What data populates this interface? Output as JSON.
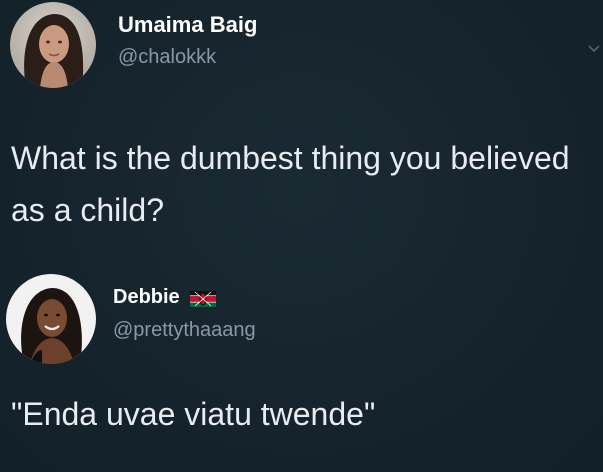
{
  "tweets": [
    {
      "author_name": "Umaima Baig",
      "handle": "@chalokkk",
      "text": "What is the dumbest thing you believed as a child?",
      "avatar_icon": "profile-photo-woman-dark-hair",
      "menu_icon": "chevron-down-icon"
    },
    {
      "author_name": "Debbie",
      "author_badge": "kenya-flag-emoji",
      "handle": "@prettythaaang",
      "text": "\"Enda uvae viatu twende\"",
      "avatar_icon": "profile-photo-woman-smiling"
    }
  ],
  "colors": {
    "background": "#15232c",
    "name": "#ffffff",
    "handle": "#8899a6",
    "text": "#e6ecf0"
  }
}
